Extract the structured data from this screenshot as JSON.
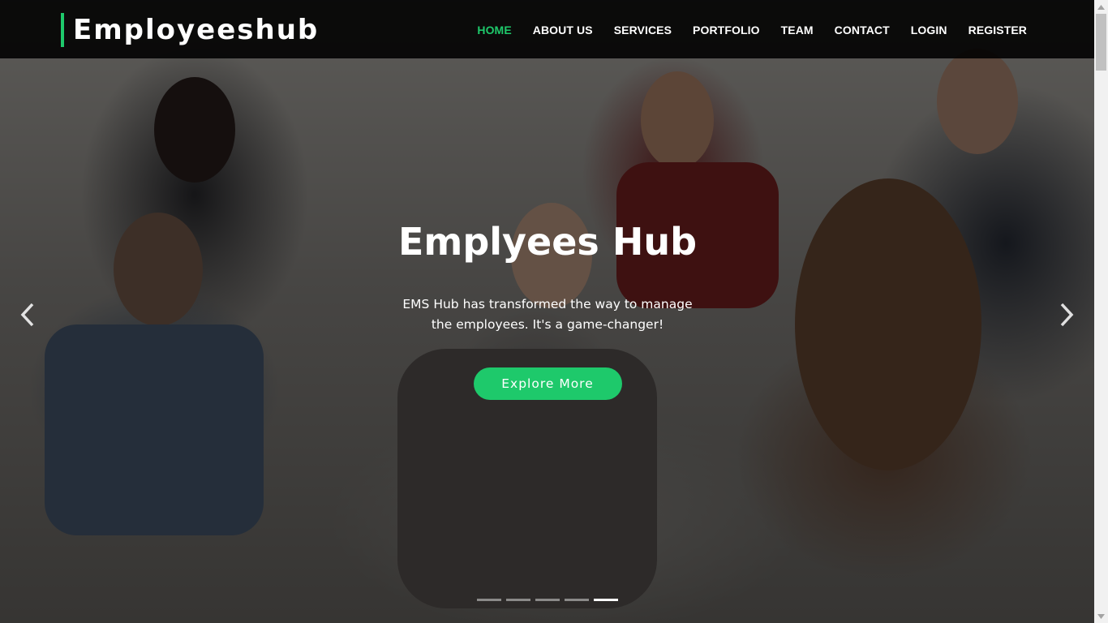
{
  "brand": {
    "name": "Employeeshub"
  },
  "nav": {
    "items": [
      {
        "label": "HOME",
        "active": true
      },
      {
        "label": "ABOUT US",
        "active": false
      },
      {
        "label": "SERVICES",
        "active": false
      },
      {
        "label": "PORTFOLIO",
        "active": false
      },
      {
        "label": "TEAM",
        "active": false
      },
      {
        "label": "CONTACT",
        "active": false
      },
      {
        "label": "LOGIN",
        "active": false
      },
      {
        "label": "REGISTER",
        "active": false
      }
    ]
  },
  "hero": {
    "title": "Emplyees Hub",
    "description": "EMS Hub has transformed the way to manage the employees. It's a game-changer!",
    "button_label": "Explore More",
    "prev_icon": "chevron-left-icon",
    "next_icon": "chevron-right-icon",
    "slide_count": 5,
    "active_slide": 5
  },
  "colors": {
    "accent": "#1ec96b",
    "navbar_bg": "#000000",
    "text": "#ffffff"
  }
}
